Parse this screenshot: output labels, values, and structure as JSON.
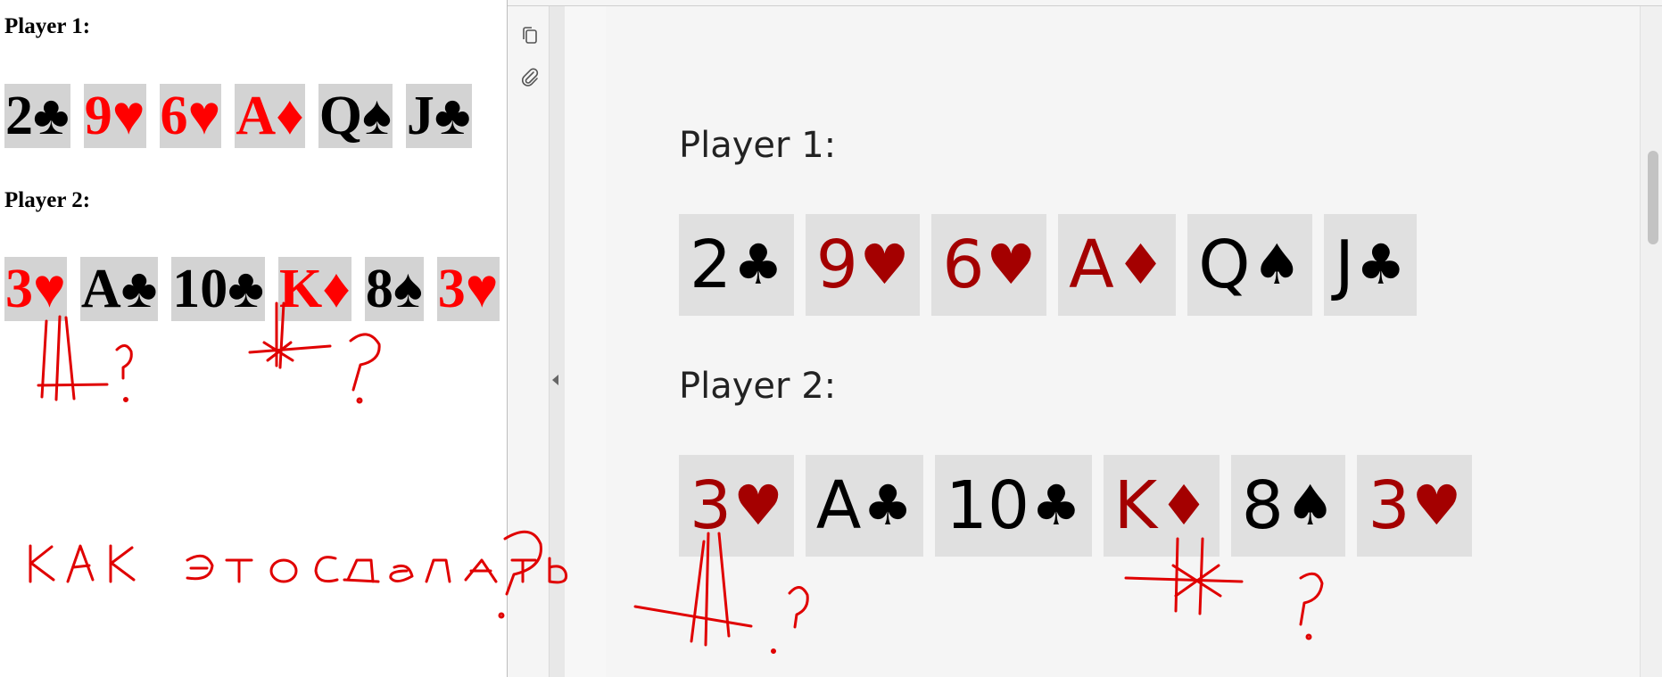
{
  "left": {
    "player1_label": "Player 1:",
    "player2_label": "Player 2:",
    "player1_cards": [
      {
        "rank": "2",
        "suit": "♣",
        "color": "black"
      },
      {
        "rank": "9",
        "suit": "♥",
        "color": "red"
      },
      {
        "rank": "6",
        "suit": "♥",
        "color": "red"
      },
      {
        "rank": "A",
        "suit": "♦",
        "color": "red"
      },
      {
        "rank": "Q",
        "suit": "♠",
        "color": "black"
      },
      {
        "rank": "J",
        "suit": "♣",
        "color": "black"
      }
    ],
    "player2_cards": [
      {
        "rank": "3",
        "suit": "♥",
        "color": "red"
      },
      {
        "rank": "A",
        "suit": "♣",
        "color": "black"
      },
      {
        "rank": "10",
        "suit": "♣",
        "color": "black"
      },
      {
        "rank": "K",
        "suit": "♦",
        "color": "red"
      },
      {
        "rank": "8",
        "suit": "♠",
        "color": "black"
      },
      {
        "rank": "3",
        "suit": "♥",
        "color": "red"
      }
    ]
  },
  "right": {
    "player1_label": "Player 1:",
    "player2_label": "Player 2:",
    "player1_cards": [
      {
        "rank": "2",
        "suit": "♣",
        "color": "black"
      },
      {
        "rank": "9",
        "suit": "♥",
        "color": "red"
      },
      {
        "rank": "6",
        "suit": "♥",
        "color": "red"
      },
      {
        "rank": "A",
        "suit": "♦",
        "color": "red"
      },
      {
        "rank": "Q",
        "suit": "♠",
        "color": "black"
      },
      {
        "rank": "J",
        "suit": "♣",
        "color": "black"
      }
    ],
    "player2_cards": [
      {
        "rank": "3",
        "suit": "♥",
        "color": "red"
      },
      {
        "rank": "A",
        "suit": "♣",
        "color": "black"
      },
      {
        "rank": "10",
        "suit": "♣",
        "color": "black"
      },
      {
        "rank": "K",
        "suit": "♦",
        "color": "red"
      },
      {
        "rank": "8",
        "suit": "♠",
        "color": "black"
      },
      {
        "rank": "3",
        "suit": "♥",
        "color": "red"
      }
    ]
  },
  "toolbar": {
    "copy_icon": "copy-icon",
    "attach_icon": "paperclip-icon",
    "collapse_icon": "collapse-left-icon"
  },
  "annotation": {
    "handwritten_text": "КАК ЭТО СДЕЛАТЬ?",
    "color": "#e00000"
  },
  "colors": {
    "left_red": "#ff0000",
    "right_red": "#a40000",
    "left_card_bg": "#d3d3d3",
    "right_card_bg": "#e0e0e0"
  }
}
